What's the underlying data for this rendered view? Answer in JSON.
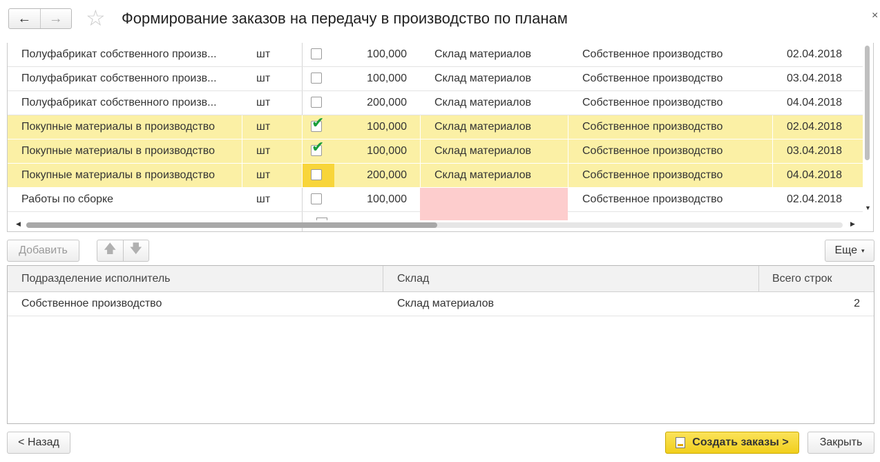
{
  "header": {
    "title": "Формирование заказов на передачу в производство по планам",
    "back_icon": "←",
    "forward_icon": "→",
    "star_icon": "☆",
    "close_icon": "×"
  },
  "top_table": {
    "rows": [
      {
        "name": "Полуфабрикат собственного произв...",
        "unit": "шт",
        "checked": false,
        "qty": "100,000",
        "warehouse": "Склад материалов",
        "department": "Собственное производство",
        "date": "02.04.2018",
        "selected": false
      },
      {
        "name": "Полуфабрикат собственного произв...",
        "unit": "шт",
        "checked": false,
        "qty": "100,000",
        "warehouse": "Склад материалов",
        "department": "Собственное производство",
        "date": "03.04.2018",
        "selected": false
      },
      {
        "name": "Полуфабрикат собственного произв...",
        "unit": "шт",
        "checked": false,
        "qty": "200,000",
        "warehouse": "Склад материалов",
        "department": "Собственное производство",
        "date": "04.04.2018",
        "selected": false
      },
      {
        "name": "Покупные материалы в производство",
        "unit": "шт",
        "checked": true,
        "qty": "100,000",
        "warehouse": "Склад материалов",
        "department": "Собственное производство",
        "date": "02.04.2018",
        "selected": true
      },
      {
        "name": "Покупные материалы в производство",
        "unit": "шт",
        "checked": true,
        "qty": "100,000",
        "warehouse": "Склад материалов",
        "department": "Собственное производство",
        "date": "03.04.2018",
        "selected": true
      },
      {
        "name": "Покупные материалы в производство",
        "unit": "шт",
        "checked": false,
        "qty": "200,000",
        "warehouse": "Склад материалов",
        "department": "Собственное производство",
        "date": "04.04.2018",
        "selected": true
      },
      {
        "name": "Работы по сборке",
        "unit": "шт",
        "checked": false,
        "qty": "100,000",
        "warehouse": "",
        "department": "Собственное производство",
        "date": "02.04.2018",
        "selected": false
      }
    ]
  },
  "toolbar": {
    "add_label": "Добавить",
    "up_icon": "🡅",
    "down_icon": "🡇",
    "more_label": "Еще",
    "more_caret": "▾"
  },
  "bottom_table": {
    "headers": {
      "department": "Подразделение исполнитель",
      "warehouse": "Склад",
      "total": "Всего строк"
    },
    "rows": [
      {
        "department": "Собственное производство",
        "warehouse": "Склад материалов",
        "total": "2"
      }
    ]
  },
  "footer": {
    "back_label": "< Назад",
    "create_label": "Создать заказы >",
    "close_label": "Закрыть"
  },
  "colors": {
    "selected_row": "#fbf0a5",
    "checkbox_highlight": "#f8d53a",
    "error_cell": "#fdcdcd",
    "primary_button": "#f1cf1c",
    "checkmark": "#1a9e3a"
  }
}
